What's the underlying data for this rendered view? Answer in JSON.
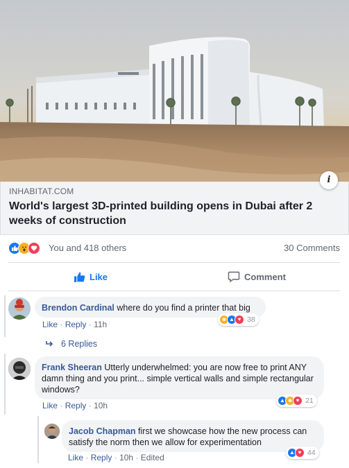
{
  "post": {
    "link": {
      "source": "INHABITAT.COM",
      "headline": "World's largest 3D-printed building opens in Dubai after 2 weeks of construction",
      "info_icon": "i"
    },
    "reactions": {
      "icons": [
        "like-icon",
        "wow-icon",
        "love-icon"
      ],
      "text": "You and 418 others",
      "comments_count": "30 Comments"
    },
    "actions": {
      "like_label": "Like",
      "comment_label": "Comment"
    }
  },
  "comments": [
    {
      "author": "Brendon Cardinal",
      "text": "where do you find a printer that big",
      "like": "Like",
      "reply": "Reply",
      "time": "11h",
      "reaction_count": "38",
      "replies_label": "6 Replies"
    },
    {
      "author": "Frank Sheeran",
      "text": "Utterly underwhelmed: you are now free to print ANY damn thing and you print... simple vertical walls and simple rectangular windows?",
      "like": "Like",
      "reply": "Reply",
      "time": "10h",
      "reaction_count": "21"
    },
    {
      "author": "Jacob Chapman",
      "text": "first we showcase how the new process can satisfy the norm then we allow for experimentation",
      "like": "Like",
      "reply": "Reply",
      "time": "10h",
      "edited": "Edited",
      "reaction_count": "44"
    }
  ],
  "colors": {
    "accent": "#1877f2",
    "author": "#385898",
    "muted": "#606770",
    "bubble": "#f2f3f5"
  }
}
